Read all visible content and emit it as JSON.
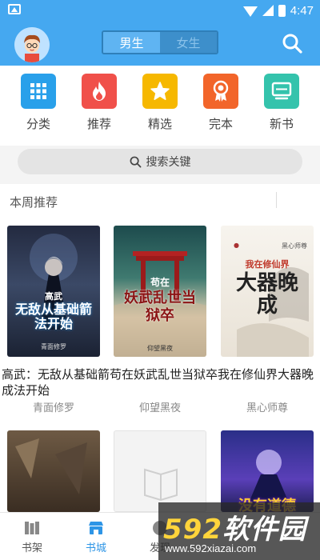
{
  "status": {
    "time": "4:47"
  },
  "header": {
    "gender_tabs": [
      {
        "label": "男生"
      },
      {
        "label": "女生"
      }
    ]
  },
  "categories": [
    {
      "label": "分类",
      "color": "#29a0ea",
      "icon": "grid-icon"
    },
    {
      "label": "推荐",
      "color": "#f0504a",
      "icon": "flame-icon"
    },
    {
      "label": "精选",
      "color": "#f6b800",
      "icon": "star-icon"
    },
    {
      "label": "完本",
      "color": "#f2652a",
      "icon": "award-icon"
    },
    {
      "label": "新书",
      "color": "#34c3ac",
      "icon": "monitor-icon"
    }
  ],
  "search": {
    "placeholder": "搜索关键"
  },
  "weekly": {
    "title": "本周推荐",
    "caption": "高武：无敌从基础箭苟在妖武乱世当狱卒我在修仙界大器晚成法开始",
    "books": [
      {
        "cover_text": "无敌从基础箭法开始",
        "cover_top": "高武",
        "cover_bottom": "青面修罗",
        "author": "青面修罗"
      },
      {
        "cover_text": "妖武乱世当狱卒",
        "cover_top": "苟在",
        "cover_bottom": "仰望黑夜",
        "author": "仰望黑夜"
      },
      {
        "cover_text": "大器晚成",
        "cover_top": "我在修仙界",
        "cover_bottom": "黑心师尊",
        "author": "黑心师尊"
      }
    ],
    "row2_cover_text": "没有道德"
  },
  "tabbar": {
    "tabs": [
      {
        "label": "书架"
      },
      {
        "label": "书城"
      },
      {
        "label": "发现"
      }
    ]
  },
  "watermark": {
    "big1": "592",
    "big2": "软件园",
    "url": "www.592xiazai.com"
  }
}
